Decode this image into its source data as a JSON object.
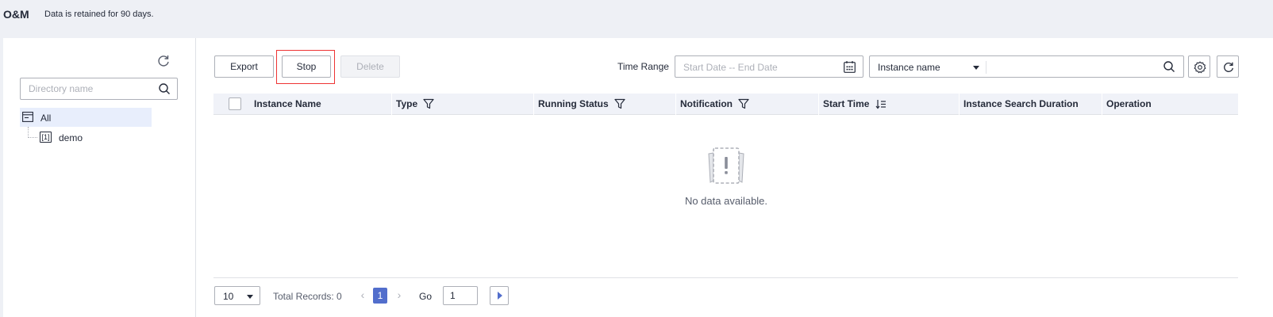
{
  "header": {
    "title": "O&M",
    "subtitle": "Data is retained for 90 days."
  },
  "sidebar": {
    "search_placeholder": "Directory name",
    "tree": [
      {
        "label": "All",
        "icon": "folder-icon",
        "selected": true
      },
      {
        "label": "demo",
        "icon": "node-icon",
        "node_glyph": "[1]"
      }
    ]
  },
  "toolbar": {
    "export_label": "Export",
    "stop_label": "Stop",
    "delete_label": "Delete",
    "time_range_label": "Time Range",
    "date_placeholder": "Start Date -- End Date",
    "filter_field": "Instance name",
    "filter_value": ""
  },
  "table": {
    "select_all_checked": false,
    "columns": [
      {
        "label": "Instance Name"
      },
      {
        "label": "Type",
        "icon": "filter-icon"
      },
      {
        "label": "Running Status",
        "icon": "filter-icon"
      },
      {
        "label": "Notification",
        "icon": "filter-icon"
      },
      {
        "label": "Start Time",
        "icon": "sort-icon"
      },
      {
        "label": "Instance Search Duration"
      },
      {
        "label": "Operation"
      }
    ],
    "rows": [],
    "empty_text": "No data available."
  },
  "pagination": {
    "page_size": "10",
    "total_text": "Total Records: 0",
    "current_page": "1",
    "go_label": "Go",
    "go_value": "1"
  },
  "colors": {
    "accent": "#526ecc",
    "highlight_border": "#ee3333",
    "header_bg": "#eef0f5"
  }
}
